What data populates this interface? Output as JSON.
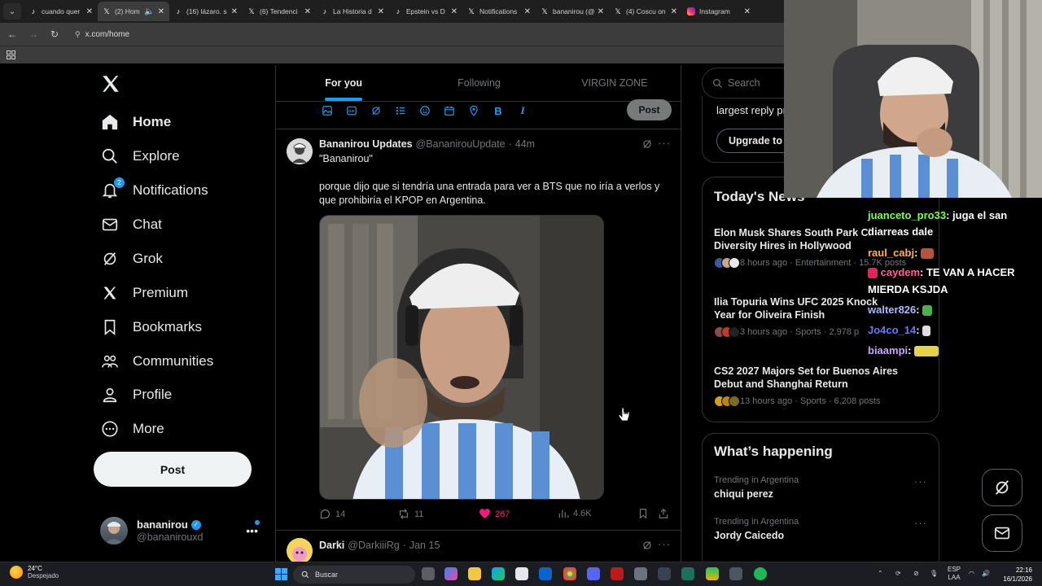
{
  "browser": {
    "tabs": [
      {
        "label": "cuando quer",
        "icon": "tiktok-icon",
        "active": false
      },
      {
        "label": "(2) Hom",
        "icon": "x-icon",
        "active": true
      },
      {
        "label": "(16) lázaro. s",
        "icon": "tiktok-icon",
        "active": false
      },
      {
        "label": "(6) Tendenci",
        "icon": "x-icon",
        "active": false
      },
      {
        "label": "La Historia d",
        "icon": "tiktok-icon",
        "active": false
      },
      {
        "label": "Epstein vs D",
        "icon": "tiktok-icon",
        "active": false
      },
      {
        "label": "Notifications",
        "icon": "x-icon",
        "active": false
      },
      {
        "label": "bananirou (@",
        "icon": "x-icon",
        "active": false
      },
      {
        "label": "(4) Coscu on",
        "icon": "x-icon",
        "active": false
      },
      {
        "label": "Instagram",
        "icon": "instagram-icon",
        "active": false
      }
    ],
    "url": "x.com/home"
  },
  "nav": {
    "items": [
      {
        "label": "Home",
        "icon": "home-icon",
        "bold": true
      },
      {
        "label": "Explore",
        "icon": "search-icon"
      },
      {
        "label": "Notifications",
        "icon": "bell-icon",
        "badge": "2"
      },
      {
        "label": "Chat",
        "icon": "mail-icon"
      },
      {
        "label": "Grok",
        "icon": "grok-icon"
      },
      {
        "label": "Premium",
        "icon": "x-icon"
      },
      {
        "label": "Bookmarks",
        "icon": "bookmark-icon"
      },
      {
        "label": "Communities",
        "icon": "communities-icon"
      },
      {
        "label": "Profile",
        "icon": "profile-icon"
      },
      {
        "label": "More",
        "icon": "more-circle-icon"
      }
    ],
    "post_label": "Post",
    "account": {
      "name": "bananirou",
      "handle": "@bananirouxd"
    }
  },
  "feed": {
    "tabs": [
      "For you",
      "Following",
      "VIRGIN ZONE"
    ],
    "composer_post_label": "Post",
    "tweet": {
      "name": "Bananirou Updates",
      "handle": "@BananirouUpdate",
      "time": "44m",
      "quote": "\"Bananirou\"",
      "text": "porque dijo que si tendría una entrada para ver a BTS que no iría a verlos y que prohibiría el KPOP en Argentina.",
      "replies": "14",
      "retweets": "11",
      "likes": "267",
      "views": "4.6K"
    },
    "tweet2": {
      "name": "Darki",
      "handle": "@DarkiiiRg",
      "time": "Jan 15"
    }
  },
  "right": {
    "search_placeholder": "Search",
    "premium_text": "largest reply pr",
    "upgrade_label": "Upgrade to",
    "news_title": "Today's News",
    "news": [
      {
        "headline": "Elon Musk Shares South Park Cl",
        "headline2": "Diversity Hires in Hollywood",
        "meta": "8 hours ago · Entertainment · 15.7K posts"
      },
      {
        "headline": "Ilia Topuria Wins UFC 2025 Knock",
        "headline2": "Year for Oliveira Finish",
        "meta": "3 hours ago · Sports · 2,978 p"
      },
      {
        "headline": "CS2 2027 Majors Set for Buenos Aires",
        "headline2": "Debut and Shanghai Return",
        "meta": "13 hours ago · Sports · 6,208 posts"
      }
    ],
    "happening_title": "What’s happening",
    "trends": [
      {
        "context": "Trending in Argentina",
        "name": "chiqui perez"
      },
      {
        "context": "Trending in Argentina",
        "name": "Jordy Caicedo"
      }
    ]
  },
  "stream_chat": [
    {
      "user": "juanceto_pro33",
      "msg": ": juga el san"
    },
    {
      "user": "",
      "msg": "diarreas dale"
    },
    {
      "user": "raul_cabj",
      "msg": ":"
    },
    {
      "user": "caydem",
      "msg": ": TE VAN A HACER"
    },
    {
      "user": "",
      "msg": "MIERDA KSJDA"
    },
    {
      "user": "walter826",
      "msg": ":"
    },
    {
      "user": "Jo4co_14",
      "msg": ":"
    },
    {
      "user": "biaampi",
      "msg": ":"
    }
  ],
  "taskbar": {
    "weather_temp": "24°C",
    "weather_desc": "Despejado",
    "search_label": "Buscar",
    "lang1": "ESP",
    "lang2": "LAA",
    "time": "22:16",
    "date": "16/1/2026"
  }
}
